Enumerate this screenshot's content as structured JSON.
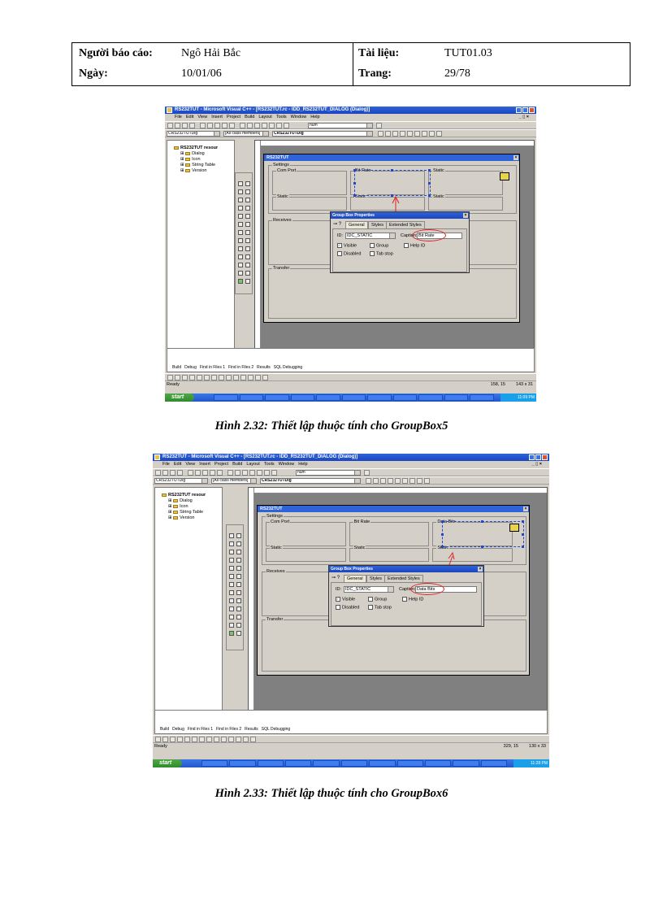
{
  "header": {
    "reporter_label": "Người báo cáo:",
    "reporter_value": "Ngô Hải Bắc",
    "date_label": "Ngày:",
    "date_value": "10/01/06",
    "document_label": "Tài liệu:",
    "document_value": "TUT01.03",
    "page_label": "Trang:",
    "page_value": "29/78"
  },
  "figures": [
    {
      "caption": "Hình 2.32: Thiết lập thuộc tính cho GroupBox5",
      "app": {
        "title": "RS232TUT - Microsoft Visual C++ - [RS232TUT.rc - IDD_RS232TUT_DIALOG (Dialog)]",
        "menu": [
          "File",
          "Edit",
          "View",
          "Insert",
          "Project",
          "Build",
          "Layout",
          "Tools",
          "Window",
          "Help"
        ],
        "mdi_buttons": "_ ▯ ×",
        "find_combo": "num",
        "class_combo": "CRS232TUTDlg",
        "filter_combo": "[All class members]",
        "member_combo": "CRS232TUTDlg",
        "tree_root": "RS232TUT resour",
        "tree_items": [
          "Dialog",
          "Icon",
          "String Table",
          "Version"
        ],
        "ws_tabs": [
          "Cla...",
          "Re...",
          "Fil..."
        ],
        "output_tabs": [
          "Build",
          "Debug",
          "Find in Files 1",
          "Find in Files 2",
          "Results",
          "SQL Debugging"
        ],
        "status": "Ready",
        "status_pos": "158, 15",
        "status_size": "143 x 31",
        "start": "start",
        "clock": "11:09 PM"
      },
      "dialog": {
        "title": "RS232TUT",
        "settings": "Settings",
        "com_port": "Com Port",
        "bit_rate": "Bit Rate",
        "static_right": "Static",
        "static_left": "Static",
        "static_mid": "Static",
        "static_right2": "Static",
        "receives": "Receives",
        "transfer": "Transfer"
      },
      "props": {
        "title": "Group Box Properties",
        "tabs": [
          "General",
          "Styles",
          "Extended Styles"
        ],
        "id_label": "ID:",
        "id_value": "IDC_STATIC",
        "caption_label": "Caption:",
        "caption_value": "Bit Rate",
        "visible": "Visible",
        "group": "Group",
        "help_id": "Help ID",
        "disabled": "Disabled",
        "tab_stop": "Tab stop"
      }
    },
    {
      "caption": "Hình 2.33: Thiết lập thuộc tính cho GroupBox6",
      "app": {
        "title": "RS232TUT - Microsoft Visual C++ - [RS232TUT.rc - IDD_RS232TUT_DIALOG (Dialog)]",
        "menu": [
          "File",
          "Edit",
          "View",
          "Insert",
          "Project",
          "Build",
          "Layout",
          "Tools",
          "Window",
          "Help"
        ],
        "mdi_buttons": "_ ▯ ×",
        "find_combo": "num",
        "class_combo": "CRS232TUTDlg",
        "filter_combo": "[All class members]",
        "member_combo": "CRS232TUTDlg",
        "tree_root": "RS232TUT resour",
        "tree_items": [
          "Dialog",
          "Icon",
          "String Table",
          "Version"
        ],
        "ws_tabs": [
          "Cla...",
          "Re...",
          "Fil..."
        ],
        "output_tabs": [
          "Build",
          "Debug",
          "Find in Files 1",
          "Find in Files 2",
          "Results",
          "SQL Debugging"
        ],
        "status": "Ready",
        "status_pos": "329, 15",
        "status_size": "130 x 33",
        "start": "start",
        "clock": "11:28 PM"
      },
      "dialog": {
        "title": "RS232TUT",
        "settings": "Settings",
        "com_port": "Com Port",
        "bit_rate": "Bit Rate",
        "static_right": "Data Bits",
        "static_left": "Static",
        "static_mid": "Static",
        "static_right2": "Static",
        "receives": "Receives",
        "transfer": "Transfer"
      },
      "props": {
        "title": "Group Box Properties",
        "tabs": [
          "General",
          "Styles",
          "Extended Styles"
        ],
        "id_label": "ID:",
        "id_value": "IDC_STATIC",
        "caption_label": "Caption:",
        "caption_value": "Data Bits",
        "visible": "Visible",
        "group": "Group",
        "help_id": "Help ID",
        "disabled": "Disabled",
        "tab_stop": "Tab stop"
      }
    }
  ]
}
